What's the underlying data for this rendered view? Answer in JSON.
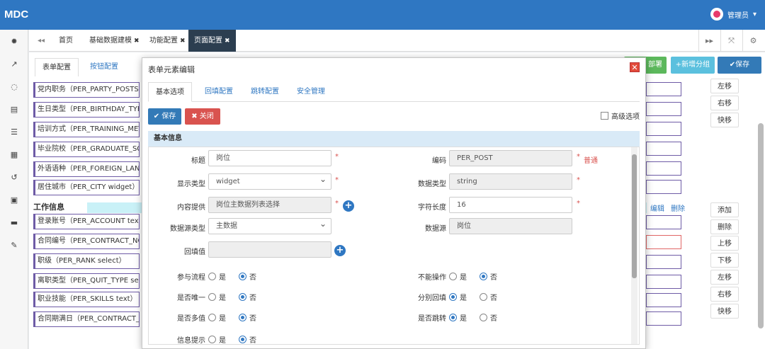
{
  "app": {
    "logo": "MDC",
    "user": "管理员"
  },
  "tabs": [
    {
      "label": "首页"
    },
    {
      "label": "基础数据建模"
    },
    {
      "label": "功能配置"
    },
    {
      "label": "页面配置"
    }
  ],
  "content": {
    "subtabs": [
      "表单配置",
      "按钮配置"
    ],
    "top_buttons": {
      "partial": "部署",
      "add_group": "+新增分组",
      "save": "✔保存"
    },
    "fields_top": [
      "党内职务（PER_PARTY_POSTS  t",
      "生日类型（PER_BIRTHDAY_TYPE",
      "培训方式（PER_TRAINING_METH",
      "毕业院校（PER_GRADUATE_SCH",
      "外语语种（PER_FOREIGN_LANGU",
      "居住城市（PER_CITY  widget）"
    ],
    "group_title": "工作信息",
    "group_links": {
      "edit": "编辑",
      "delete": "删除"
    },
    "fields_bottom": [
      "登录账号（PER_ACCOUNT  text）",
      "合同编号（PER_CONTRACT_NO",
      "职级（PER_RANK  select）",
      "离职类型（PER_QUIT_TYPE  sele",
      "职业技能（PER_SKILLS  text）",
      "合同期满日（PER_CONTRACT_EN"
    ],
    "side_buttons_top": [
      "左移",
      "右移",
      "快移"
    ],
    "side_buttons_bottom": [
      "添加",
      "删除",
      "上移",
      "下移",
      "左移",
      "右移",
      "快移"
    ]
  },
  "modal": {
    "title": "表单元素编辑",
    "close": "✕",
    "tabs": [
      "基本选项",
      "回填配置",
      "跳转配置",
      "安全管理"
    ],
    "save": "✔ 保存",
    "close_btn": "✖ 关闭",
    "advanced": "高级选项",
    "section": "基本信息",
    "form": {
      "title_label": "标题",
      "title_value": "岗位",
      "code_label": "编码",
      "code_value": "PER_POST",
      "code_note": "普通",
      "display_type_label": "显示类型",
      "display_type_value": "widget",
      "data_type_label": "数据类型",
      "data_type_value": "string",
      "provider_label": "内容提供",
      "provider_value": "岗位主数据列表选择",
      "length_label": "字符长度",
      "length_value": "16",
      "ds_type_label": "数据源类型",
      "ds_type_value": "主数据",
      "ds_label": "数据源",
      "ds_value": "岗位",
      "backfill_label": "回填值",
      "backfill_value": "",
      "required_mark": "*",
      "radios": [
        {
          "label": "参与流程",
          "yes": "是",
          "no": "否",
          "selected": "no"
        },
        {
          "label": "不能操作",
          "yes": "是",
          "no": "否",
          "selected": "no"
        },
        {
          "label": "是否唯一",
          "yes": "是",
          "no": "否",
          "selected": "no"
        },
        {
          "label": "分别回填",
          "yes": "是",
          "no": "否",
          "selected": "yes"
        },
        {
          "label": "是否多值",
          "yes": "是",
          "no": "否",
          "selected": "no"
        },
        {
          "label": "是否跳转",
          "yes": "是",
          "no": "否",
          "selected": "yes"
        },
        {
          "label": "信息提示",
          "yes": "是",
          "no": "否",
          "selected": "no"
        }
      ]
    }
  },
  "colors": {
    "topbar": "#2f77c2",
    "active_tab": "#2c3e50",
    "green": "#5cb85c",
    "cyan_btn": "#5bc0de",
    "blue_btn": "#337ab7",
    "danger": "#d9534f"
  }
}
